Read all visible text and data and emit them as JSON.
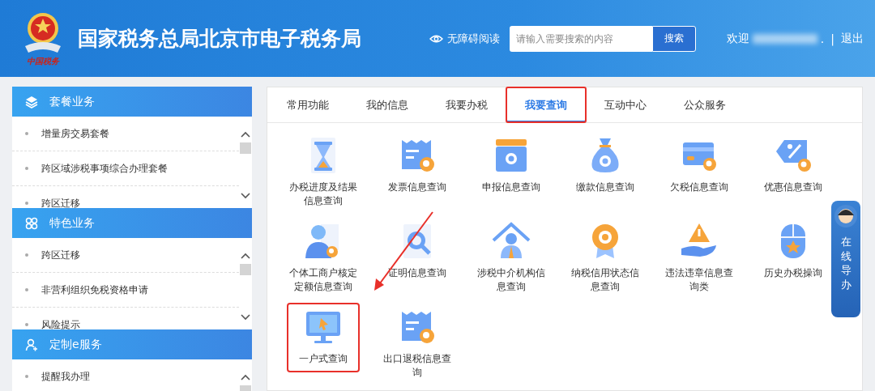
{
  "header": {
    "title": "国家税务总局北京市电子税务局",
    "emblem_caption": "中国税务",
    "accessibility": "无障碍阅读",
    "search": {
      "placeholder": "请输入需要搜索的内容",
      "button": "搜索"
    },
    "welcome": "欢迎",
    "welcome_end": ".",
    "separator": "|",
    "logout": "退出"
  },
  "sidebar": [
    {
      "title": "套餐业务",
      "items": [
        "增量房交易套餐",
        "跨区域涉税事项综合办理套餐",
        "跨区迁移"
      ]
    },
    {
      "title": "特色业务",
      "items": [
        "跨区迁移",
        "非营利组织免税资格申请",
        "风险提示"
      ]
    },
    {
      "title": "定制e服务",
      "items": [
        "提醒我办理"
      ]
    }
  ],
  "tabs": [
    {
      "label": "常用功能",
      "selected": false,
      "highlighted": false
    },
    {
      "label": "我的信息",
      "selected": false,
      "highlighted": false
    },
    {
      "label": "我要办税",
      "selected": false,
      "highlighted": false
    },
    {
      "label": "我要查询",
      "selected": true,
      "highlighted": true
    },
    {
      "label": "互动中心",
      "selected": false,
      "highlighted": false
    },
    {
      "label": "公众服务",
      "selected": false,
      "highlighted": false
    }
  ],
  "services": [
    {
      "label": "办税进度及结果信息查询",
      "highlighted": false
    },
    {
      "label": "发票信息查询",
      "highlighted": false
    },
    {
      "label": "申报信息查询",
      "highlighted": false
    },
    {
      "label": "缴款信息查询",
      "highlighted": false
    },
    {
      "label": "欠税信息查询",
      "highlighted": false
    },
    {
      "label": "优惠信息查询",
      "highlighted": false
    },
    {
      "label": "个体工商户核定定额信息查询",
      "highlighted": false
    },
    {
      "label": "证明信息查询",
      "highlighted": false
    },
    {
      "label": "涉税中介机构信息查询",
      "highlighted": false
    },
    {
      "label": "纳税信用状态信息查询",
      "highlighted": false
    },
    {
      "label": "违法违章信息查询类",
      "highlighted": false
    },
    {
      "label": "历史办税操询",
      "highlighted": false
    },
    {
      "label": "一户式查询",
      "highlighted": true
    },
    {
      "label": "出口退税信息查询",
      "highlighted": false
    }
  ],
  "guide": {
    "label": "在线导办"
  }
}
